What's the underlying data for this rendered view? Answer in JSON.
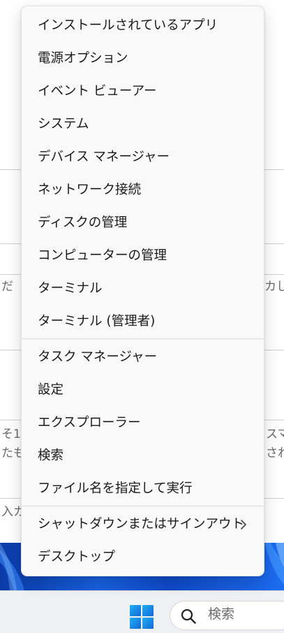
{
  "background_fragments": {
    "frag1": "だ",
    "frag2": "カし",
    "frag3": "そ1",
    "frag4": "たも",
    "frag5": "スマ",
    "frag6": "され",
    "frag7": "入カ"
  },
  "context_menu": {
    "group1": [
      {
        "label": "インストールされているアプリ"
      },
      {
        "label": "電源オプション"
      },
      {
        "label": "イベント ビューアー"
      },
      {
        "label": "システム"
      },
      {
        "label": "デバイス マネージャー"
      },
      {
        "label": "ネットワーク接続"
      },
      {
        "label": "ディスクの管理"
      },
      {
        "label": "コンピューターの管理"
      },
      {
        "label": "ターミナル"
      },
      {
        "label": "ターミナル (管理者)"
      }
    ],
    "group2": [
      {
        "label": "タスク マネージャー"
      },
      {
        "label": "設定"
      },
      {
        "label": "エクスプローラー"
      },
      {
        "label": "検索"
      },
      {
        "label": "ファイル名を指定して実行"
      }
    ],
    "group3": [
      {
        "label": "シャットダウンまたはサインアウト",
        "icon": "chevron-right-icon"
      },
      {
        "label": "デスクトップ"
      }
    ]
  },
  "taskbar": {
    "start_icon": "windows-logo-icon",
    "search_icon": "search-icon",
    "search_placeholder": "検索"
  },
  "colors": {
    "menu_bg": "#f9f9f9",
    "taskbar_bg": "#eef0f3",
    "windows_blue": "#1a8fe0"
  }
}
